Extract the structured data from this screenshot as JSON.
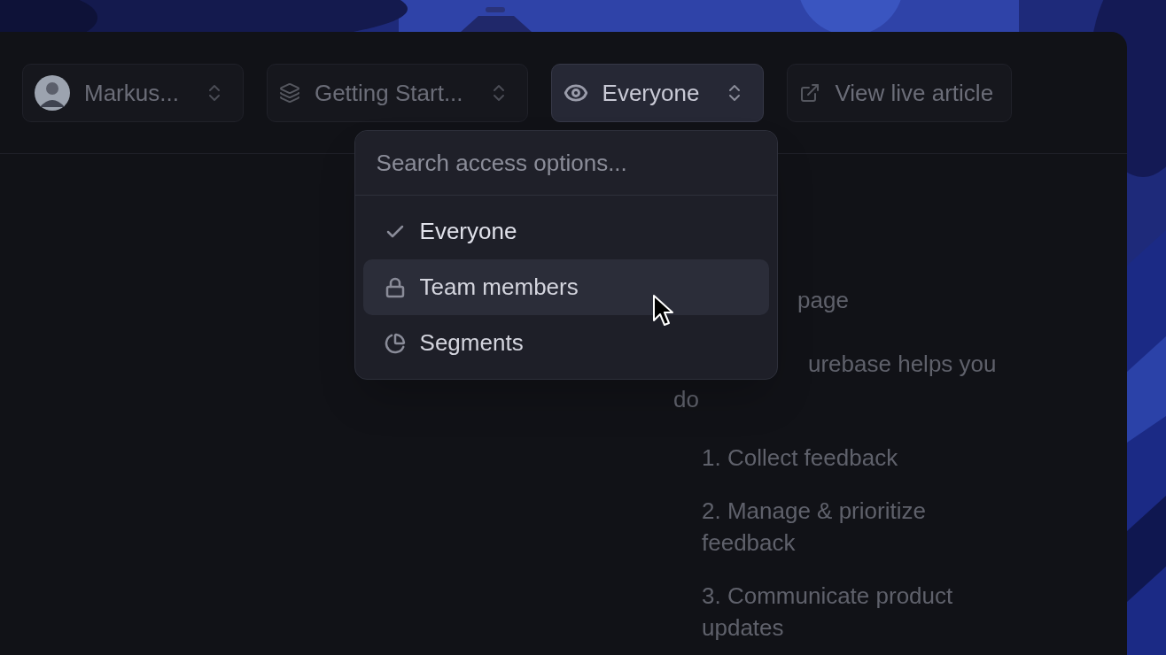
{
  "toolbar": [
    {
      "kind": "avatar",
      "label": "Markus...",
      "open": false
    },
    {
      "kind": "collection",
      "label": "Getting Start...",
      "open": false
    },
    {
      "kind": "visibility",
      "label": "Everyone",
      "open": true
    },
    {
      "kind": "link",
      "label": "View live article",
      "open": false
    }
  ],
  "access_menu": {
    "search": {
      "placeholder": "Search access options..."
    },
    "options": [
      {
        "label": "Everyone",
        "selected": true,
        "highlighted": false
      },
      {
        "kind": "team",
        "label": "Team members",
        "selected": false,
        "highlighted": true
      },
      {
        "kind": "segments",
        "label": "Segments",
        "selected": false,
        "highlighted": false
      }
    ]
  },
  "article": {
    "fragments": [
      {
        "kind": "tail",
        "text": "page"
      },
      {
        "kind": "tail",
        "text": "urebase helps you"
      },
      {
        "kind": "line",
        "text": "do"
      }
    ],
    "list": [
      "1. Collect feedback",
      "2. Manage & prioritize feedback",
      "3. Communicate product updates"
    ]
  }
}
